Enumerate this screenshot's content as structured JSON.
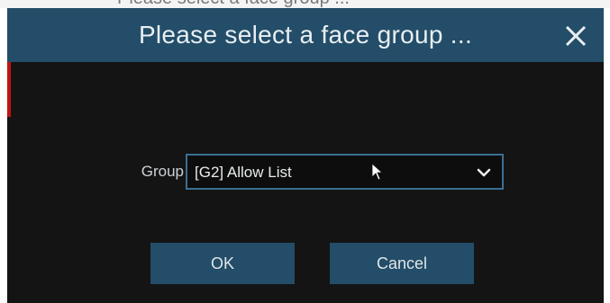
{
  "background_title": "Please select a face group ...",
  "dialog": {
    "title": "Please select a face group ...",
    "close_icon": "close-icon",
    "group_label": "Group",
    "group_select": {
      "selected_value": "[G2] Allow List",
      "dropdown_icon": "chevron-down-icon"
    },
    "ok_label": "OK",
    "cancel_label": "Cancel"
  },
  "colors": {
    "titlebar": "#234d68",
    "body": "#141414",
    "select_border": "#3a6f92",
    "button": "#234d68",
    "text": "#e8eef2"
  }
}
